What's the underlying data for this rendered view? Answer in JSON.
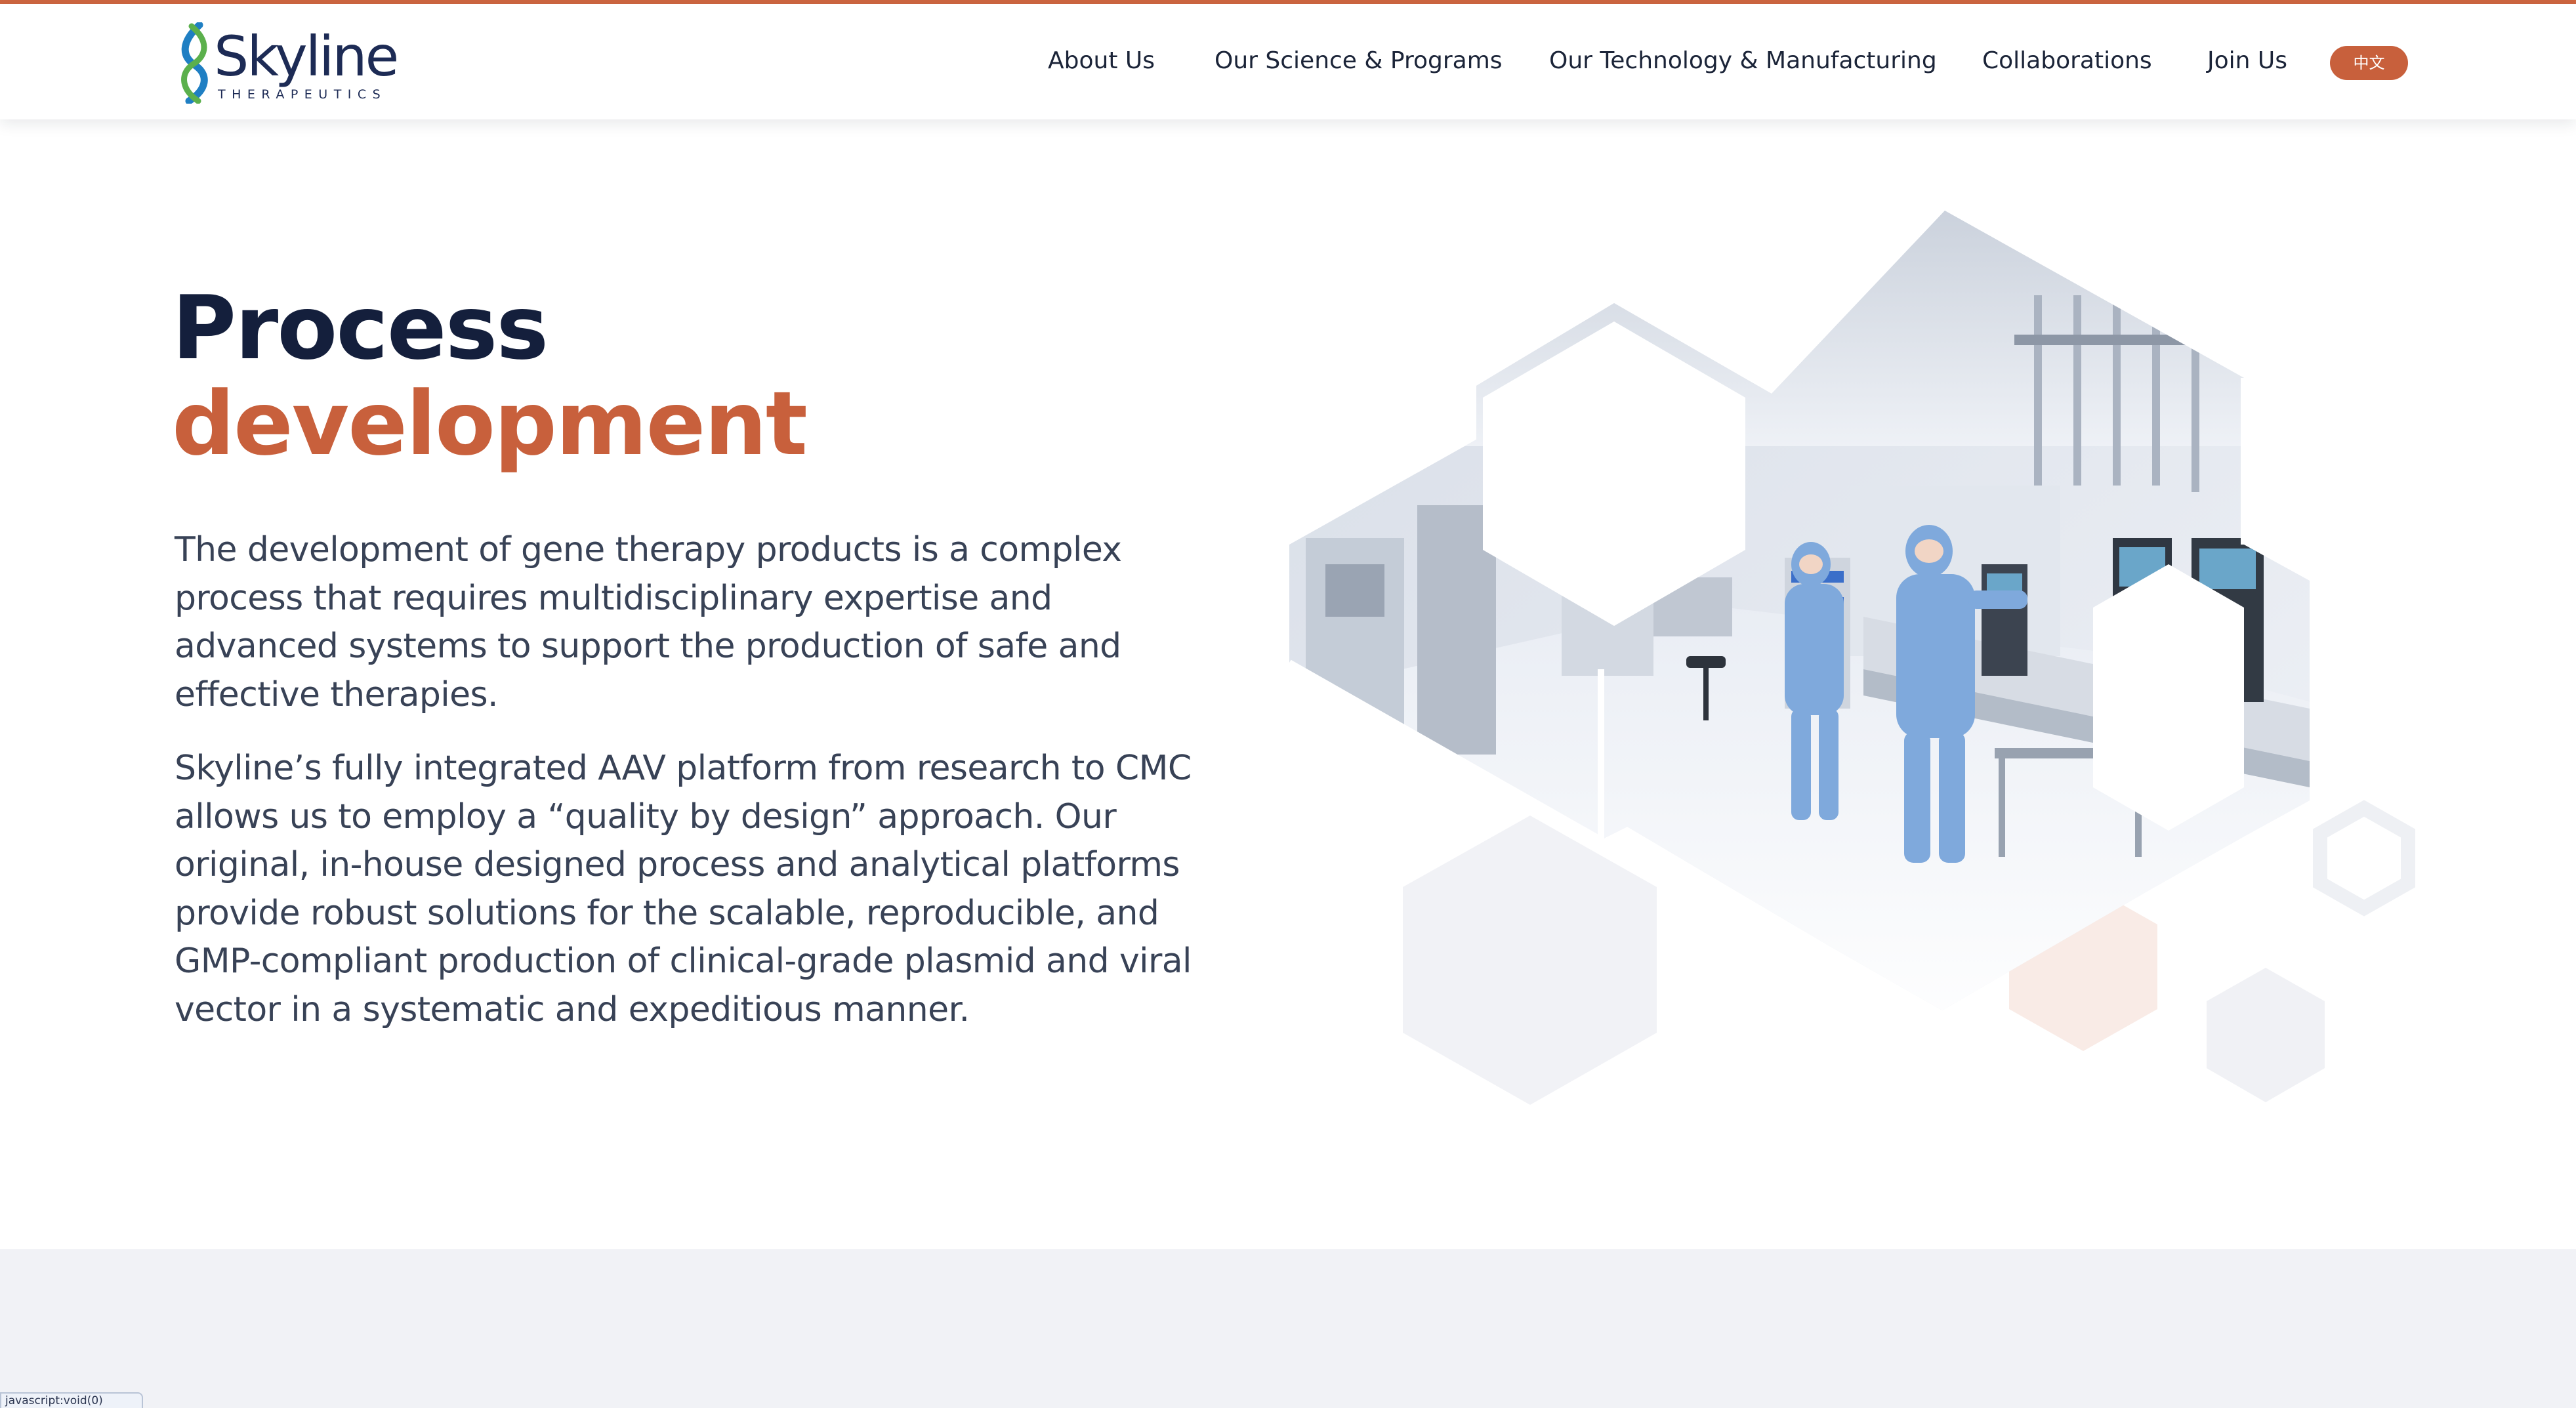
{
  "brand": {
    "name": "Skyline",
    "tagline": "THERAPEUTICS",
    "colors": {
      "accent": "#c8603c",
      "navy": "#1d2b55",
      "logo_green": "#5bb04c",
      "logo_blue": "#1f7fc3"
    }
  },
  "nav": {
    "items": [
      {
        "label": "About Us"
      },
      {
        "label": "Our Science & Programs"
      },
      {
        "label": "Our Technology & Manufacturing"
      },
      {
        "label": "Collaborations"
      },
      {
        "label": "Join Us"
      }
    ],
    "language_button": "中文"
  },
  "hero": {
    "title_line1": "Process",
    "title_line2": "development",
    "paragraphs": [
      "The development of gene therapy products is a complex process that requires multidisciplinary expertise and advanced systems to support the production of safe and effective therapies.",
      "Skyline’s fully integrated AAV platform from research to CMC allows us to employ a “quality by design” approach. Our original, in-house designed process and analytical platforms provide robust solutions for the scalable, reproducible, and GMP-compliant production of clinical-grade plasmid and viral vector in a systematic and expeditious manner."
    ],
    "image_icon": "lab-cleanroom-hexagon-collage"
  },
  "status_bar": {
    "text": "javascript:void(0)"
  }
}
